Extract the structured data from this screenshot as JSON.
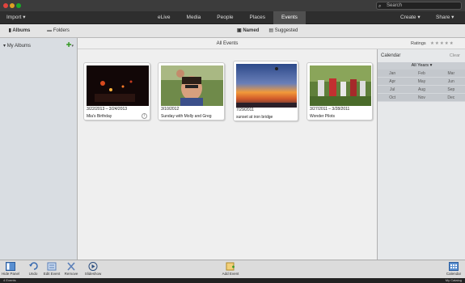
{
  "search": {
    "placeholder": "Search"
  },
  "menubar": {
    "import": "Import",
    "create": "Create",
    "share": "Share"
  },
  "tabs": [
    "eLive",
    "Media",
    "People",
    "Places",
    "Events"
  ],
  "active_tab": "Events",
  "left_tabs": {
    "albums": "Albums",
    "folders": "Folders"
  },
  "view_tabs": {
    "named": "Named",
    "suggested": "Suggested"
  },
  "left_panel": {
    "my_albums": "My Albums"
  },
  "main": {
    "title": "All Events"
  },
  "ratings": {
    "label": "Ratings",
    "stars": "★★★★★"
  },
  "events": [
    {
      "dates": "3/22/2013 – 3/24/2013",
      "name": "Mia's Birthday"
    },
    {
      "dates": "3/10/2012",
      "name": "Sunday with Molly and Greg"
    },
    {
      "dates": "7/29/2011",
      "name": "sunset at iron bridge"
    },
    {
      "dates": "3/27/2011 – 3/28/2011",
      "name": "Wonder Pilots"
    }
  ],
  "calendar": {
    "title": "Calendar",
    "clear": "Clear",
    "years": "All Years",
    "months": [
      "Jan",
      "Feb",
      "Mar",
      "Apr",
      "May",
      "Jun",
      "Jul",
      "Aug",
      "Sep",
      "Oct",
      "Nov",
      "Dec"
    ]
  },
  "bottombar": {
    "hide_panel": "Hide Panel",
    "undo": "Undo",
    "edit_event": "Edit Event",
    "remove": "Remove",
    "slideshow": "Slideshow",
    "add_event": "Add Event",
    "calendar": "Calendar"
  },
  "status": {
    "left": "4 Events",
    "right": "My Catalog"
  },
  "colors": {
    "accent_green": "#3a9b2a",
    "tab_active": "#505050"
  }
}
